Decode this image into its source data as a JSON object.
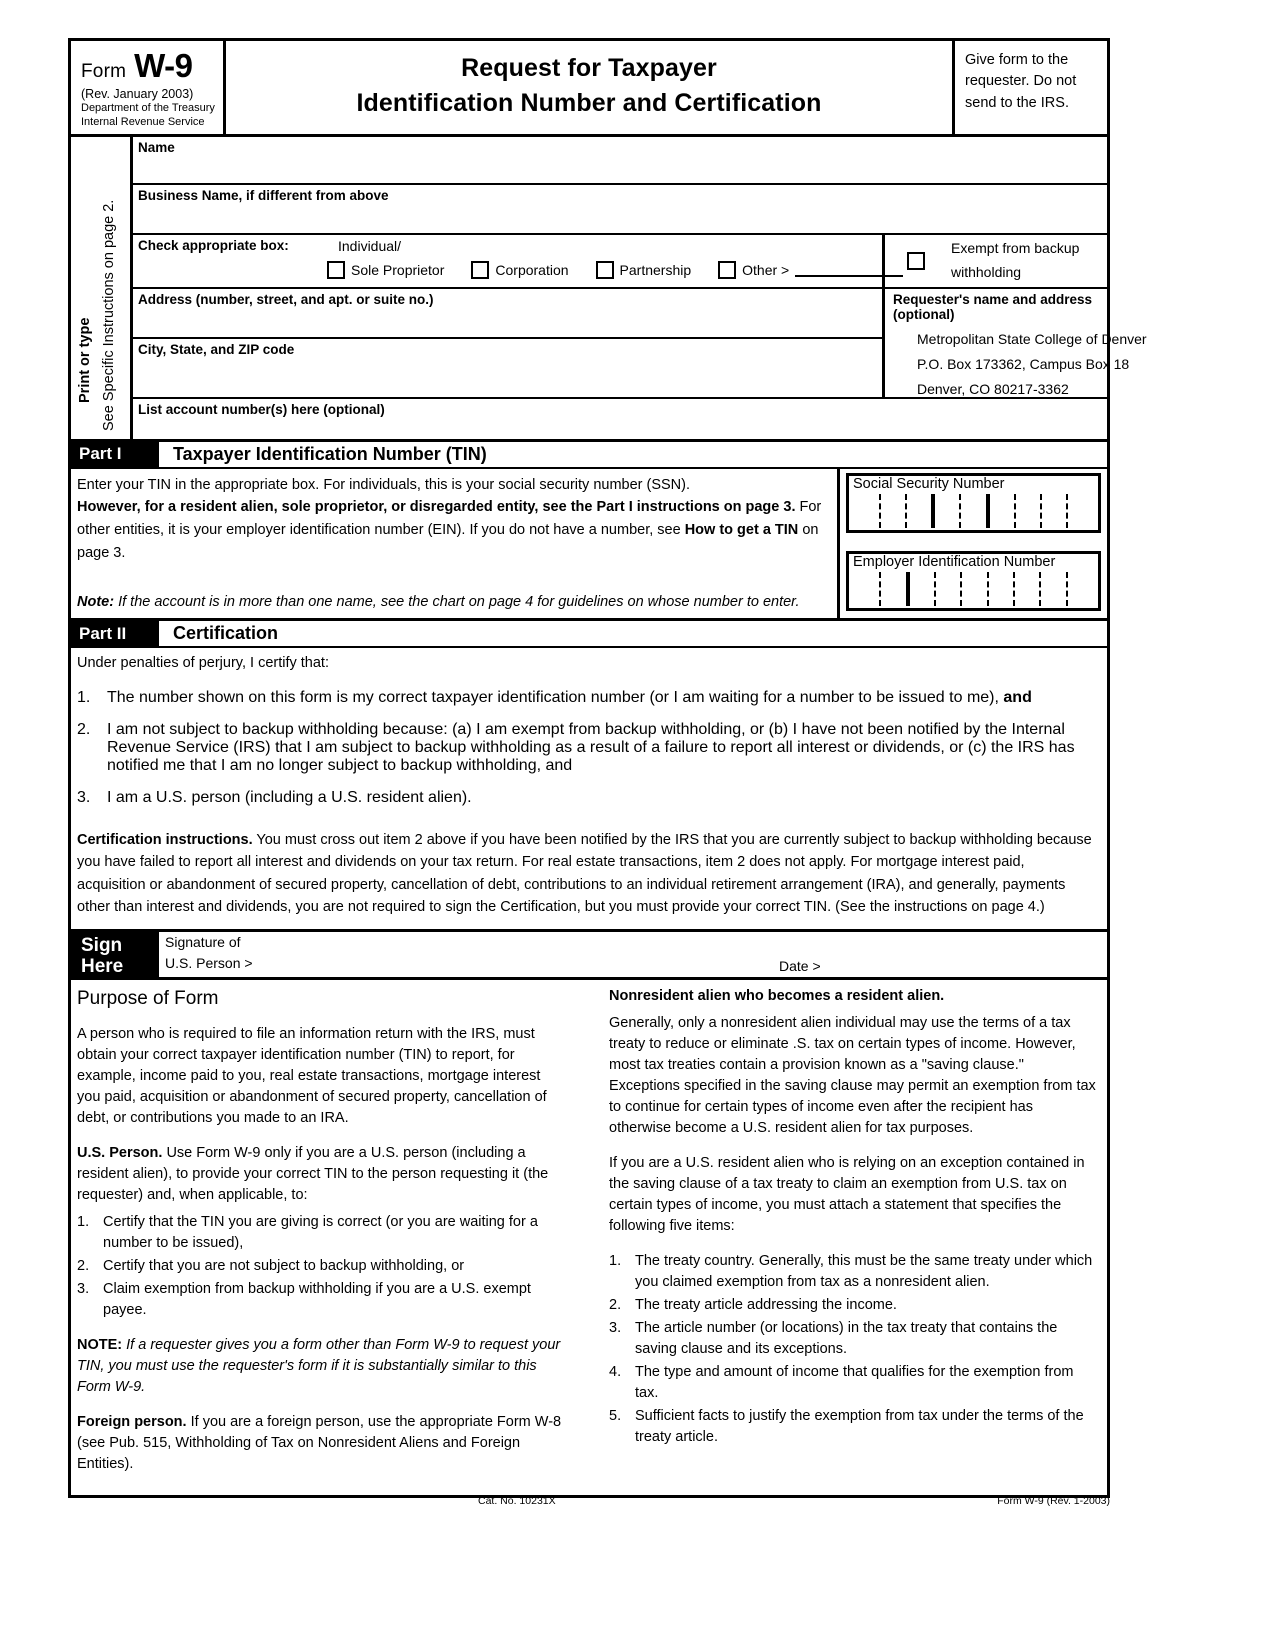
{
  "header": {
    "form_word": "Form",
    "form_number": "W-9",
    "revision": "(Rev. January 2003)",
    "dept_line1": "Department of the Treasury",
    "dept_line2": "Internal Revenue Service",
    "title_line1": "Request for Taxpayer",
    "title_line2": "Identification Number and Certification",
    "give_form_note": "Give form to the requester.  Do not send to the IRS."
  },
  "sidebar": {
    "print_or_type": "Print or type",
    "see_instructions": "See Specific Instructions on page 2."
  },
  "fields": {
    "name_label": "Name",
    "name_value": "",
    "business_name_label": "Business Name, if different from above",
    "business_name_value": "",
    "check_box_label": "Check appropriate box:",
    "individual_label": "Individual/",
    "checkboxes": [
      {
        "label": "Sole Proprietor",
        "checked": false
      },
      {
        "label": "Corporation",
        "checked": false
      },
      {
        "label": "Partnership",
        "checked": false
      },
      {
        "label": "Other >",
        "checked": false
      }
    ],
    "other_value": "",
    "exempt_line1": "Exempt from backup",
    "exempt_line2": "withholding",
    "exempt_checked": false,
    "address_label": "Address (number, street, and apt. or suite no.)",
    "address_value": "",
    "city_state_zip_label": "City, State, and ZIP code",
    "city_state_zip_value": "",
    "account_numbers_label": "List account number(s) here (optional)",
    "account_numbers_value": "",
    "requester_label": "Requester's name and address (optional)",
    "requester_line1": "Metropolitan State College of Denver",
    "requester_line2": "P.O. Box 173362, Campus Box 18",
    "requester_line3": "Denver, CO   80217-3362"
  },
  "part1": {
    "tag": "Part I",
    "title": "Taxpayer Identification Number (TIN)",
    "p1": "Enter your TIN in the appropriate box.  For individuals, this is your social security number (SSN).",
    "p2_bold": "However, for a resident alien, sole proprietor, or disregarded entity, see the Part I instructions on page 3.",
    "p2_rest": "  For other entities, it is your employer identification number (EIN).  If you do not have a number, see ",
    "p2_bold2": "How to get a TIN",
    "p2_tail": " on page 3.",
    "note_label": "Note:",
    "note_text": "  If the account is in more than one name, see the chart on page 4 for guidelines on whose number to enter.",
    "ssn_label": "Social Security Number",
    "ssn_value": "",
    "ein_label": "Employer Identification Number",
    "ein_value": ""
  },
  "part2": {
    "tag": "Part II",
    "title": "Certification",
    "intro": "Under penalties of perjury, I certify that:",
    "items": [
      {
        "num": "1.",
        "text": "The number shown on this form is my correct taxpayer identification number (or I am waiting for a number to be issued to me), ",
        "bold_tail": "and"
      },
      {
        "num": "2.",
        "text": "I am not subject to backup withholding because: (a) I am exempt from backup withholding, or (b) I have not been notified by the Internal Revenue Service (IRS) that I am subject to backup withholding as a result of a failure to report all interest or dividends, or (c) the IRS has notified me that I am no longer subject to backup withholding, and"
      },
      {
        "num": "3.",
        "text": "I am a U.S. person (including a U.S. resident alien)."
      }
    ],
    "cert_heading": "Certification instructions.",
    "cert_text": "  You must cross out item 2 above if you have been notified by the IRS that you are currently subject to backup withholding because you have failed to report all interest and dividends on your tax return.  For real estate transactions, item 2 does not apply.  For mortgage interest paid, acquisition or abandonment of secured property, cancellation of debt, contributions to an individual retirement arrangement (IRA), and generally, payments other than interest and dividends, you are not required to sign the Certification, but you must provide your correct TIN.  (See the instructions on page 4.)"
  },
  "sign": {
    "tag_line1": "Sign",
    "tag_line2": "Here",
    "signature_line1": "Signature of",
    "signature_line2": "U.S. Person >",
    "signature_value": "",
    "date_label": "Date >",
    "date_value": ""
  },
  "instructions": {
    "purpose_title": "Purpose of Form",
    "left": {
      "p1": "A person who is required to file an information return with the IRS, must obtain your correct taxpayer identification number (TIN) to report, for example, income paid to you, real estate transactions, mortgage interest you paid, acquisition or abandonment of secured property, cancellation of debt, or contributions you made to an IRA.",
      "us_person_head": "U.S. Person.",
      "us_person_text": "  Use Form W-9 only if you are a U.S. person (including a resident alien), to provide your correct TIN to the person requesting it (the requester) and, when applicable, to:",
      "list": [
        {
          "n": "1.",
          "t": "Certify that the TIN you are giving is correct (or you are waiting for a number to be issued),"
        },
        {
          "n": "2.",
          "t": "Certify that you are not subject to backup withholding, or"
        },
        {
          "n": "3.",
          "t": "Claim exemption from backup withholding if you are a U.S. exempt payee."
        }
      ],
      "note_head": "NOTE:",
      "note_text": "  If a requester gives you a form other than Form W-9 to request your TIN, you must use the requester's form if it is substantially similar to this Form W-9.",
      "foreign_head": "Foreign person.",
      "foreign_text": "  If you are a foreign person, use the appropriate Form W-8 (see Pub. 515, Withholding of Tax on Nonresident Aliens and Foreign Entities)."
    },
    "right": {
      "head": "Nonresident alien who becomes a resident alien.",
      "p1": "Generally, only a nonresident alien individual may use the terms of a tax treaty to reduce or eliminate .S. tax on certain types of income.  However, most tax treaties contain a provision known as a \"saving clause.\"  Exceptions specified in the saving clause may permit an exemption from tax to continue for certain types of income even after the recipient has otherwise become a U.S. resident alien for tax purposes.",
      "p2": "If you are a U.S. resident alien who is relying on an exception contained in the saving clause of a tax treaty to claim an exemption from U.S. tax on certain types of income, you must attach a statement that specifies the following five items:",
      "list": [
        {
          "n": "1.",
          "t": "The treaty country.  Generally, this must be the same treaty under which you claimed exemption from tax as a nonresident alien."
        },
        {
          "n": "2.",
          "t": "The treaty article addressing the income."
        },
        {
          "n": "3.",
          "t": "The article number (or locations) in the tax treaty that contains the saving clause and its exceptions."
        },
        {
          "n": "4.",
          "t": "The type and amount of income that qualifies for the exemption from tax."
        },
        {
          "n": "5.",
          "t": "Sufficient facts to justify the exemption from tax under the terms of the treaty article."
        }
      ]
    }
  },
  "footer": {
    "catalog": "Cat. No. 10231X",
    "form_rev": "Form W-9 (Rev. 1-2003)"
  }
}
